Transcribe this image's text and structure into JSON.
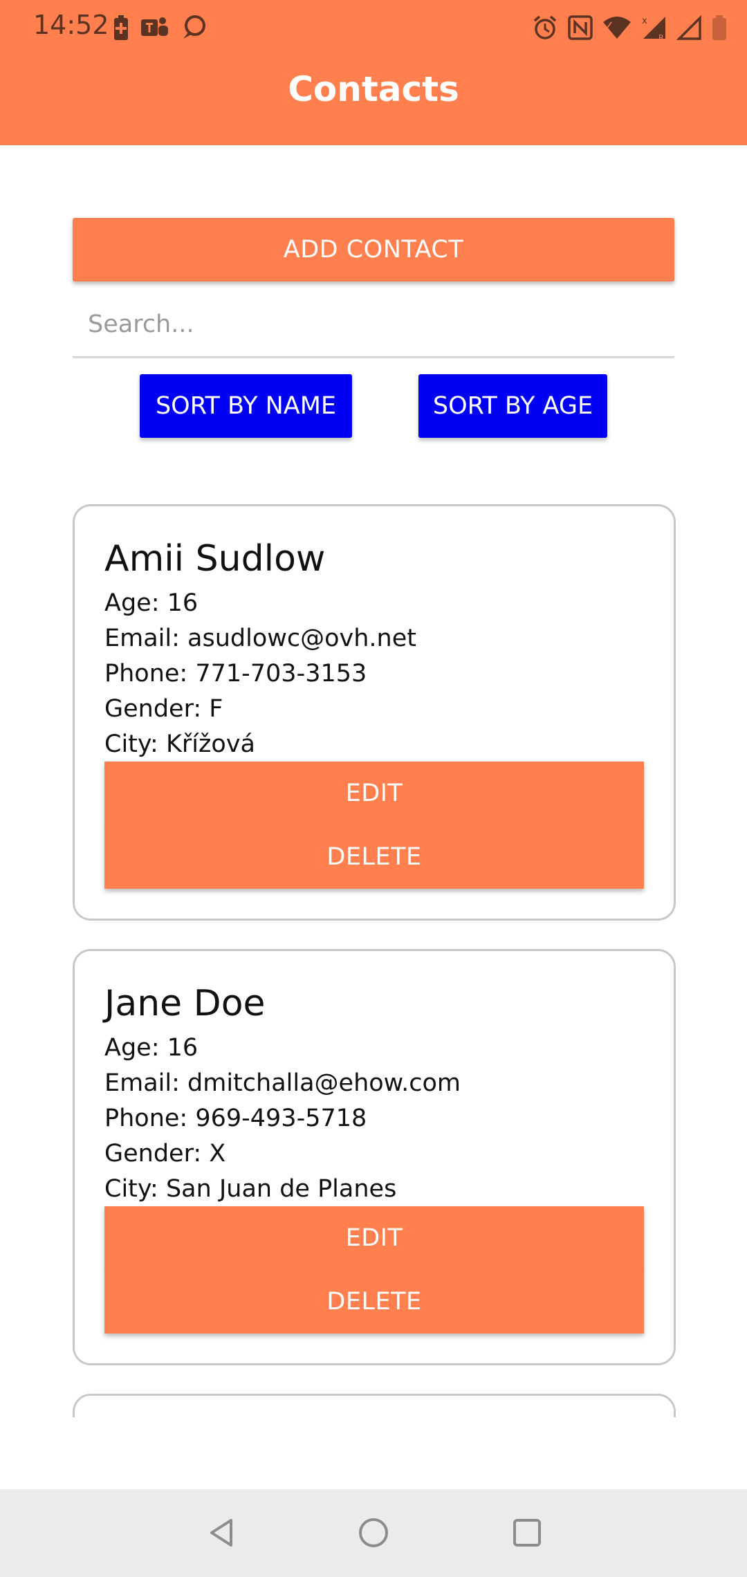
{
  "status_bar": {
    "time": "14:52"
  },
  "header": {
    "title": "Contacts"
  },
  "toolbar": {
    "add_contact_label": "ADD CONTACT",
    "search_placeholder": "Search...",
    "sort_by_name_label": "SORT BY NAME",
    "sort_by_age_label": "SORT BY AGE"
  },
  "contacts": [
    {
      "name": "Amii Sudlow",
      "age": "Age: 16",
      "email": "Email: asudlowc@ovh.net",
      "phone": "Phone: 771-703-3153",
      "gender": "Gender: F",
      "city": "City: Křížová",
      "edit_label": "EDIT",
      "delete_label": "DELETE"
    },
    {
      "name": "Jane Doe",
      "age": "Age: 16",
      "email": "Email: dmitchalla@ehow.com",
      "phone": "Phone: 969-493-5718",
      "gender": "Gender: X",
      "city": "City: San Juan de Planes",
      "edit_label": "EDIT",
      "delete_label": "DELETE"
    }
  ],
  "colors": {
    "accent": "#FF7F4F",
    "sort_button": "#0000F5"
  },
  "icons": {
    "status_left": [
      "battery-saver-icon",
      "teams-icon",
      "chat-bubble-icon"
    ],
    "status_right": [
      "alarm-icon",
      "nfc-icon",
      "wifi-icon",
      "signal-roaming-icon",
      "signal-icon",
      "battery-icon"
    ],
    "nav": [
      "back-icon",
      "home-icon",
      "recents-icon"
    ]
  }
}
